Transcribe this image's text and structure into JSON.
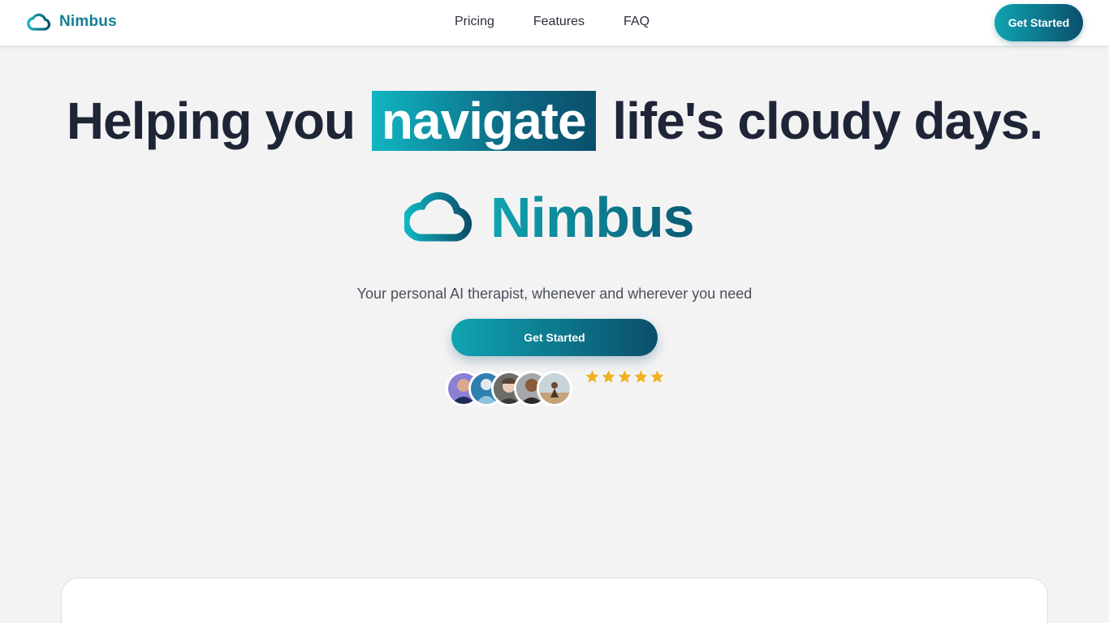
{
  "nav": {
    "brand": "Nimbus",
    "links": [
      "Pricing",
      "Features",
      "FAQ"
    ],
    "cta": "Get Started"
  },
  "hero": {
    "headline_before": "Helping you",
    "headline_highlight": "navigate",
    "headline_after": "life's cloudy days.",
    "logo_text": "Nimbus",
    "subtitle": "Your personal AI therapist, whenever and wherever you need",
    "cta": "Get Started",
    "rating_stars": 5
  },
  "colors": {
    "accent_start": "#0fa4b1",
    "accent_end": "#0b4f6c",
    "text_dark": "#1e2536",
    "star": "#f2b01e",
    "background": "#f3f3f4"
  },
  "icons": {
    "brand": "cloud-icon",
    "rating": "star-icon"
  }
}
